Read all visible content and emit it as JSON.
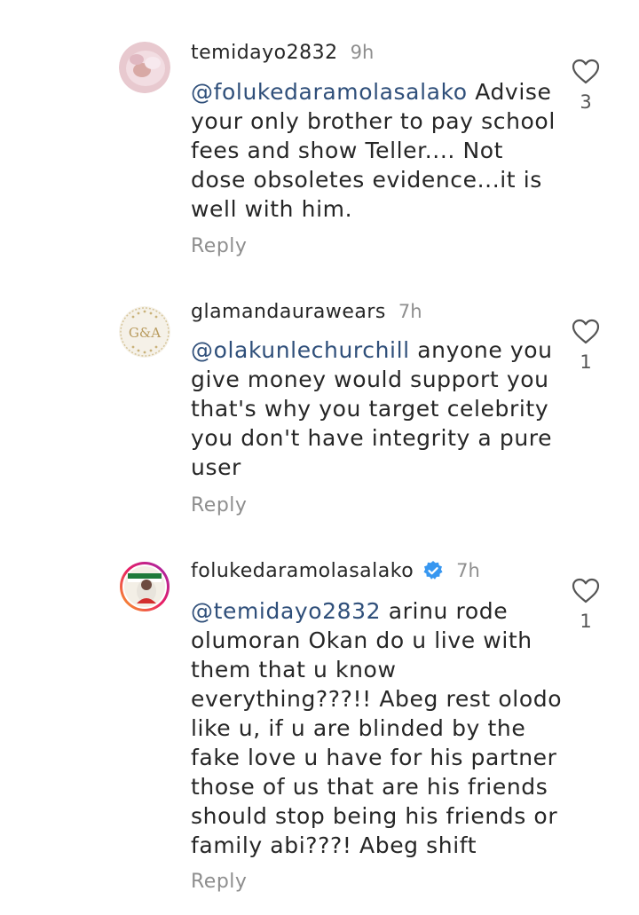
{
  "comments": [
    {
      "username": "temidayo2832",
      "time": "9h",
      "mention": "@folukedaramolasalako",
      "text": " Advise your only brother to pay school fees and show Teller.... Not dose obsoletes evidence...it is well with him.",
      "reply_label": "Reply",
      "likes": "3",
      "verified": false
    },
    {
      "username": "glamandaurawears",
      "time": "7h",
      "mention": "@olakunlechurchill",
      "text": " anyone you give money would support you that's why you target celebrity you don't have integrity a pure user",
      "reply_label": "Reply",
      "likes": "1",
      "avatar_logo_text": "G&A",
      "verified": false
    },
    {
      "username": "folukedaramolasalako",
      "time": "7h",
      "mention": "@temidayo2832",
      "text": " arinu rode olumoran Okan do u live with them that u know everything???!! Abeg rest olodo like u, if u are blinded by the fake love u have for his partner those of us that are his friends should stop being his friends or family abi???! Abeg shift",
      "reply_label": "Reply",
      "likes": "1",
      "verified": true
    }
  ],
  "colors": {
    "mention": "#2f4f7a",
    "meta": "#8e8e8e",
    "verified": "#3897f0"
  }
}
